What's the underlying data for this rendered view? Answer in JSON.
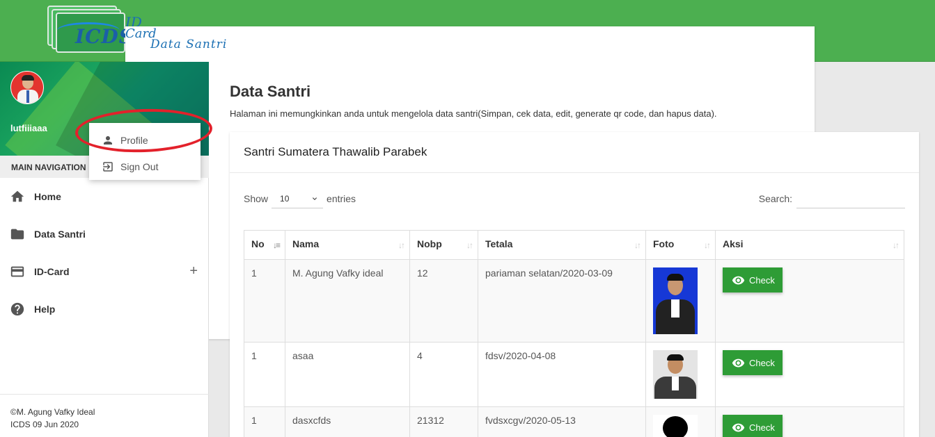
{
  "header": {
    "logo_text": "ICDS",
    "logo_script_top": "ID",
    "logo_script_card": "Card",
    "logo_script_data": "Data Santri"
  },
  "sidebar": {
    "username": "lutfiiiaaa",
    "section_label": "MAIN NAVIGATION",
    "items": [
      {
        "label": "Home",
        "icon": "home-icon"
      },
      {
        "label": "Data Santri",
        "icon": "folder-icon"
      },
      {
        "label": "ID-Card",
        "icon": "credit-card-icon",
        "expand": "+"
      },
      {
        "label": "Help",
        "icon": "help-icon"
      }
    ],
    "footer_line1": "©M. Agung Vafky Ideal",
    "footer_line2": "ICDS 09 Jun 2020"
  },
  "dropdown": {
    "items": [
      {
        "label": "Profile",
        "icon": "person-icon"
      },
      {
        "label": "Sign Out",
        "icon": "sign-out-icon"
      }
    ]
  },
  "main": {
    "title": "Data Santri",
    "description": "Halaman ini memungkinkan anda untuk mengelola data santri(Simpan, cek data, edit, generate qr code, dan hapus data).",
    "card_title": "Santri Sumatera Thawalib Parabek",
    "show_label": "Show",
    "entries_value": "10",
    "entries_label": "entries",
    "search_label": "Search:",
    "search_value": "",
    "table": {
      "headers": [
        "No",
        "Nama",
        "Nobp",
        "Tetala",
        "Foto",
        "Aksi"
      ],
      "rows": [
        {
          "no": "1",
          "nama": "M. Agung Vafky ideal",
          "nobp": "12",
          "tetala": "pariaman selatan/2020-03-09",
          "action": "Check"
        },
        {
          "no": "1",
          "nama": "asaa",
          "nobp": "4",
          "tetala": "fdsv/2020-04-08",
          "action": "Check"
        },
        {
          "no": "1",
          "nama": "dasxcfds",
          "nobp": "21312",
          "tetala": "fvdsxcgv/2020-05-13",
          "action": "Check"
        }
      ]
    }
  },
  "colors": {
    "topbar": "#4caf50",
    "check_button": "#2e9c36",
    "annotation_ellipse": "#e3212b"
  }
}
